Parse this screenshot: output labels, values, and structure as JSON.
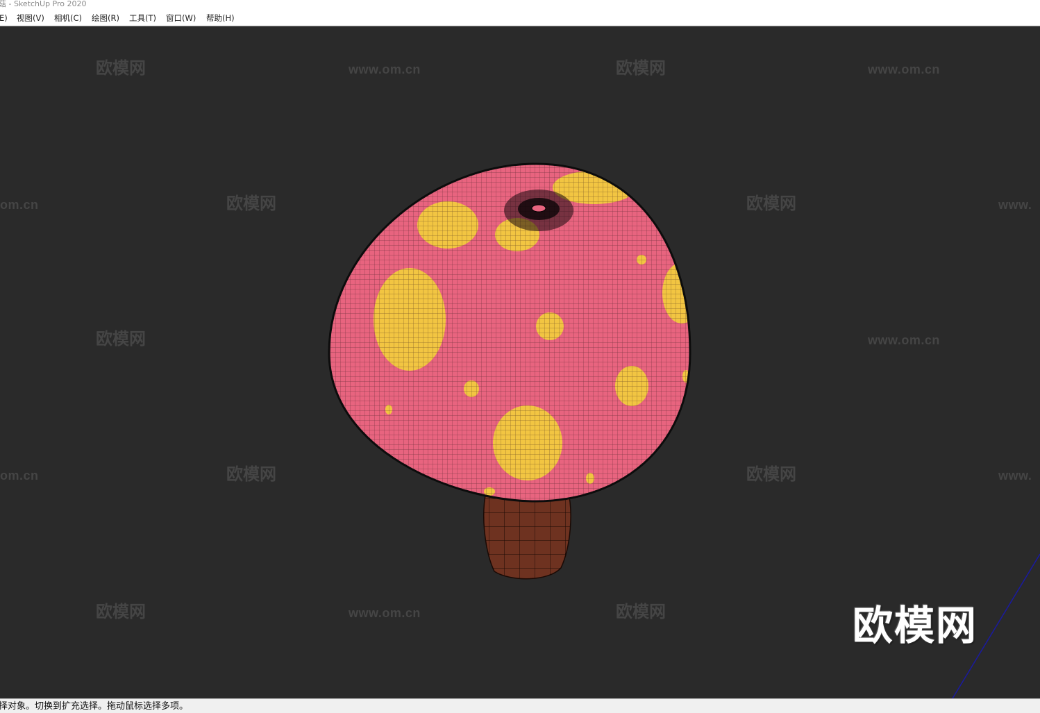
{
  "window": {
    "title": "菇 - SketchUp Pro 2020"
  },
  "menu": {
    "items": [
      {
        "label": "E)"
      },
      {
        "label": "视图(V)"
      },
      {
        "label": "相机(C)"
      },
      {
        "label": "绘图(R)"
      },
      {
        "label": "工具(T)"
      },
      {
        "label": "窗口(W)"
      },
      {
        "label": "帮助(H)"
      }
    ]
  },
  "viewport": {
    "watermark_cn": "欧模网",
    "watermark_url": "www.om.cn",
    "watermark_url_cut_left": "om.cn",
    "watermark_url_cut_right": "www.",
    "watermark_large": "欧模网",
    "colors": {
      "background": "#2a2a2a",
      "cap_pink": "#e8647f",
      "cap_spots": "#f2c542",
      "stem_brown": "#6e3220",
      "axis_blue": "#1a1aa0"
    }
  },
  "status": {
    "text": "择对象。切换到扩充选择。拖动鼠标选择多项。"
  }
}
